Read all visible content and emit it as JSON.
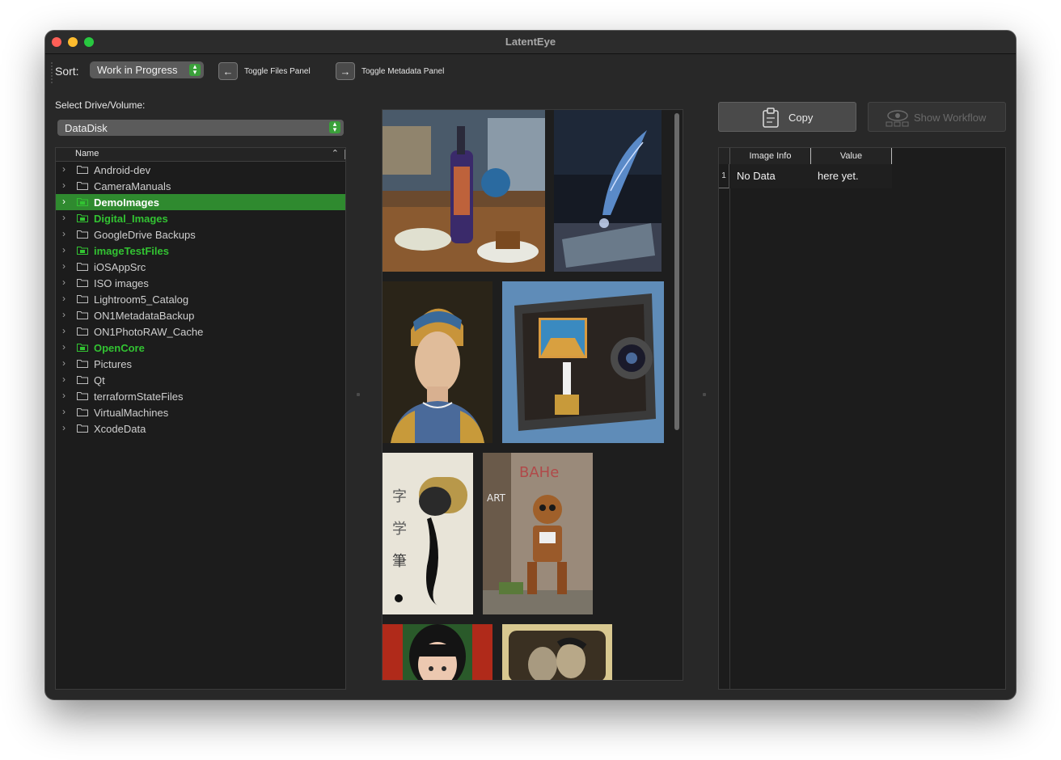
{
  "app": {
    "title": "LatentEye"
  },
  "toolbar": {
    "sort_label": "Sort:",
    "sort_value": "Work in Progress",
    "toggle_files_label": "Toggle Files Panel",
    "toggle_metadata_label": "Toggle Metadata Panel"
  },
  "left_panel": {
    "drive_label": "Select Drive/Volume:",
    "drive_value": "DataDisk",
    "tree_header": "Name",
    "items": [
      {
        "label": "Android-dev",
        "highlight": false,
        "selected": false
      },
      {
        "label": "CameraManuals",
        "highlight": false,
        "selected": false
      },
      {
        "label": "DemoImages",
        "highlight": true,
        "selected": true
      },
      {
        "label": "Digital_Images",
        "highlight": true,
        "selected": false
      },
      {
        "label": "GoogleDrive Backups",
        "highlight": false,
        "selected": false
      },
      {
        "label": "imageTestFiles",
        "highlight": true,
        "selected": false
      },
      {
        "label": "iOSAppSrc",
        "highlight": false,
        "selected": false
      },
      {
        "label": "ISO images",
        "highlight": false,
        "selected": false
      },
      {
        "label": "Lightroom5_Catalog",
        "highlight": false,
        "selected": false
      },
      {
        "label": "ON1MetadataBackup",
        "highlight": false,
        "selected": false
      },
      {
        "label": "ON1PhotoRAW_Cache",
        "highlight": false,
        "selected": false
      },
      {
        "label": "OpenCore",
        "highlight": true,
        "selected": false
      },
      {
        "label": "Pictures",
        "highlight": false,
        "selected": false
      },
      {
        "label": "Qt",
        "highlight": false,
        "selected": false
      },
      {
        "label": "terraformStateFiles",
        "highlight": false,
        "selected": false
      },
      {
        "label": "VirtualMachines",
        "highlight": false,
        "selected": false
      },
      {
        "label": "XcodeData",
        "highlight": false,
        "selected": false
      }
    ]
  },
  "gallery": {
    "thumbnails": [
      {
        "name": "thumb-wine-bottle-dinner",
        "palette": [
          "#7a5a3a",
          "#c9803a",
          "#2b3a5a",
          "#e8c080"
        ]
      },
      {
        "name": "thumb-quill-book",
        "palette": [
          "#141a26",
          "#2e3e5a",
          "#6fa0d8",
          "#c8b890"
        ]
      },
      {
        "name": "thumb-pearl-girl-portrait",
        "palette": [
          "#2a2418",
          "#c89a3a",
          "#3a5a8a",
          "#e0c0a0"
        ]
      },
      {
        "name": "thumb-camera-painter",
        "palette": [
          "#4a7aa8",
          "#2a2a2a",
          "#c8a060",
          "#e8e8e8"
        ]
      },
      {
        "name": "thumb-ink-pen-calligraphy",
        "palette": [
          "#e8e4d8",
          "#b8a070",
          "#111111",
          "#7a6a50"
        ]
      },
      {
        "name": "thumb-robot-graffiti-wall",
        "palette": [
          "#8a7a6a",
          "#a06a40",
          "#c8b8a8",
          "#5a6a3a"
        ]
      },
      {
        "name": "thumb-anime-girl",
        "palette": [
          "#2a6a2a",
          "#c03020",
          "#1a1a1a",
          "#e8c8b0"
        ]
      },
      {
        "name": "thumb-vintage-couple-photo",
        "palette": [
          "#d8c890",
          "#2a2418",
          "#9a8a6a",
          "#c8b898"
        ]
      }
    ]
  },
  "right_panel": {
    "copy_label": "Copy",
    "workflow_label": "Show Workflow",
    "table_headers": [
      "Image Info",
      "Value"
    ],
    "rows": [
      {
        "num": "1",
        "key": "No Data",
        "value": "here yet."
      }
    ]
  },
  "colors": {
    "accent_green": "#32c332",
    "selection_green": "#2f8a2f",
    "window_bg": "#282828"
  }
}
